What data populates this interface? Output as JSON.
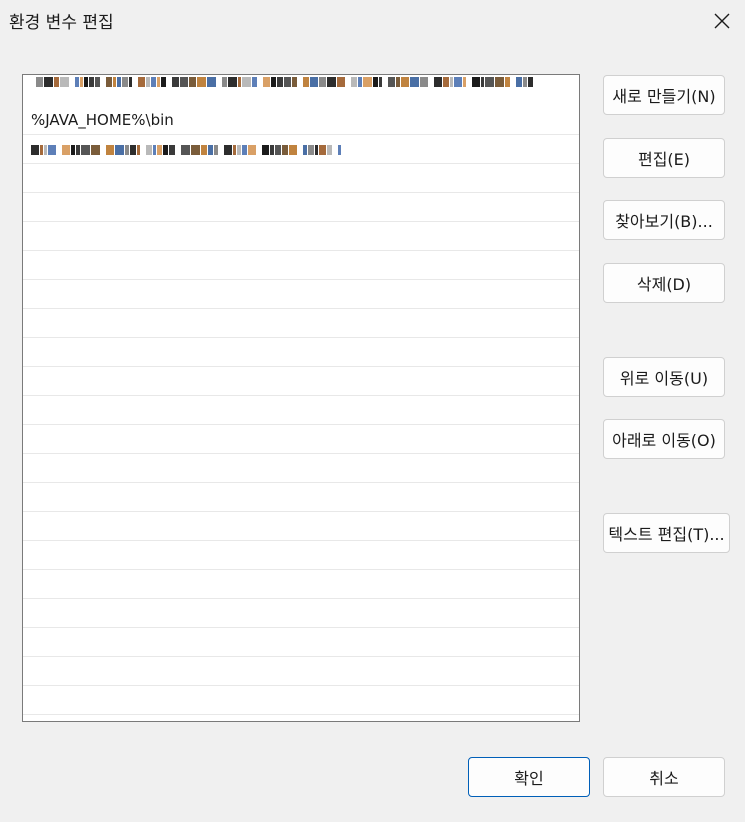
{
  "window": {
    "title": "환경 변수 편집"
  },
  "list": {
    "entries": [
      "",
      "%JAVA_HOME%\\bin",
      "",
      "",
      "",
      "",
      "",
      "",
      "",
      "",
      "",
      "",
      "",
      "",
      "",
      "",
      "",
      "",
      "",
      "",
      "",
      ""
    ]
  },
  "buttons": {
    "new": "새로 만들기(N)",
    "edit": "편집(E)",
    "browse": "찾아보기(B)...",
    "delete": "삭제(D)",
    "move_up": "위로 이동(U)",
    "move_down": "아래로 이동(O)",
    "edit_text": "텍스트 편집(T)...",
    "ok": "확인",
    "cancel": "취소"
  },
  "icons": {
    "close": "close-icon"
  },
  "colors": {
    "background": "#f0f0f0",
    "primary_border": "#005fb8"
  }
}
